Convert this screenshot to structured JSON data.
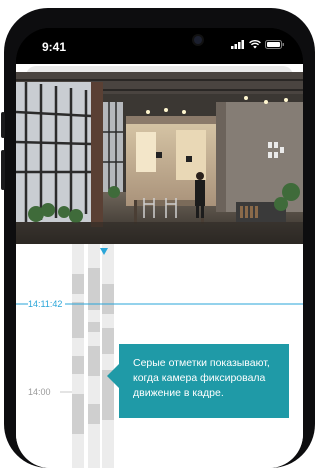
{
  "status_bar": {
    "time": "9:41"
  },
  "timeline": {
    "current_time_label": "14:11:42",
    "hour_label": "14:00"
  },
  "tooltip": {
    "text": "Серые отметки показывают, когда камера фиксировала движение в кадре."
  },
  "colors": {
    "accent": "#2aa6d9",
    "tooltip_bg": "#1f9aa7",
    "motion_mark": "#cfcfcf",
    "track_bg": "#ececec"
  },
  "icons": [
    "signal-icon",
    "wifi-icon",
    "battery-icon",
    "playhead-marker-icon"
  ]
}
